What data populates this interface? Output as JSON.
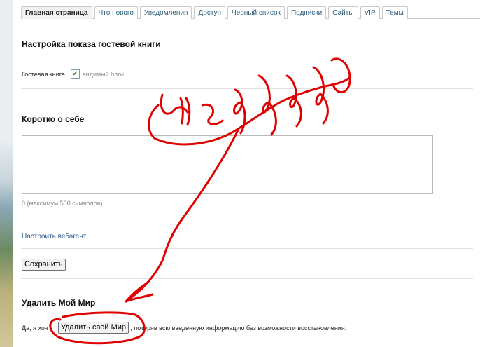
{
  "tabs": [
    {
      "label": "Главная страница",
      "active": true
    },
    {
      "label": "Что нового"
    },
    {
      "label": "Уведомления"
    },
    {
      "label": "Доступ"
    },
    {
      "label": "Черный список"
    },
    {
      "label": "Подписки"
    },
    {
      "label": "Сайты"
    },
    {
      "label": "VIP"
    },
    {
      "label": "Темы"
    }
  ],
  "guestbook": {
    "title": "Настройка показа гостевой книги",
    "label": "Гостевая книга",
    "checkbox_checked": true,
    "checkbox_text": "видимый блок"
  },
  "about": {
    "title": "Коротко о себе",
    "value": "",
    "counter": "0 (максимум 500 символов)"
  },
  "links": {
    "webagent": "Настроить вебагент"
  },
  "buttons": {
    "save": "Сохранить",
    "delete": "Удалить свой Мир"
  },
  "delete_section": {
    "title": "Удалить Мой Мир",
    "text_before": "Да, я хоч",
    "text_after": ", потеряв всю введенную информацию без возможности восстановления."
  },
  "annotation": {
    "handwriting": "Не идти",
    "color": "#e00000"
  }
}
